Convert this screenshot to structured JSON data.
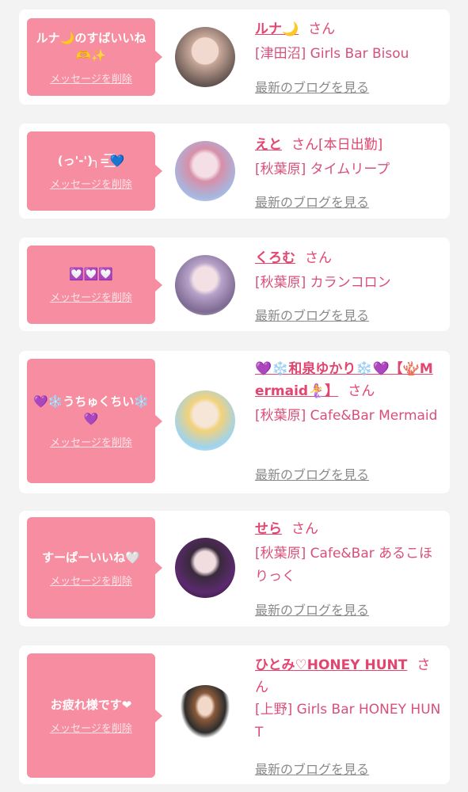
{
  "delete_label": "メッセージを削除",
  "blog_label": "最新のブログを見る",
  "san_label": "さん",
  "colors": {
    "bubble": "#f78da0",
    "name": "#e2456f",
    "background": "#f3f3f3"
  },
  "cards": [
    {
      "message": "ルナ🌙のすばいいね🫶✨",
      "name": "ルナ🌙",
      "extra": "",
      "shop": "[津田沼] Girls Bar Bisou"
    },
    {
      "message": "(っ'-')╮=͟͟͞͞💙",
      "name": "えと",
      "extra": "[本日出勤]",
      "shop": "[秋葉原] タイムリープ"
    },
    {
      "message": "💟💟💟",
      "name": "くろむ",
      "extra": "",
      "shop": "[秋葉原] カランコロン"
    },
    {
      "message": "💜❄️うちゅくちい❄️💜",
      "name": "💜❄️和泉ゆかり❄️💜【🪸Mermaid🧜‍♀️】",
      "extra": "",
      "shop": "[秋葉原] Cafe&Bar Mermaid"
    },
    {
      "message": "すーぱーいいね🤍",
      "name": "せら",
      "extra": "",
      "shop": "[秋葉原] Cafe&Bar あるこほりっく"
    },
    {
      "message": "お疲れ様です❤",
      "name": "ひとみ♡HONEY HUNT",
      "extra": "",
      "shop": "[上野] Girls Bar HONEY HUNT"
    }
  ]
}
